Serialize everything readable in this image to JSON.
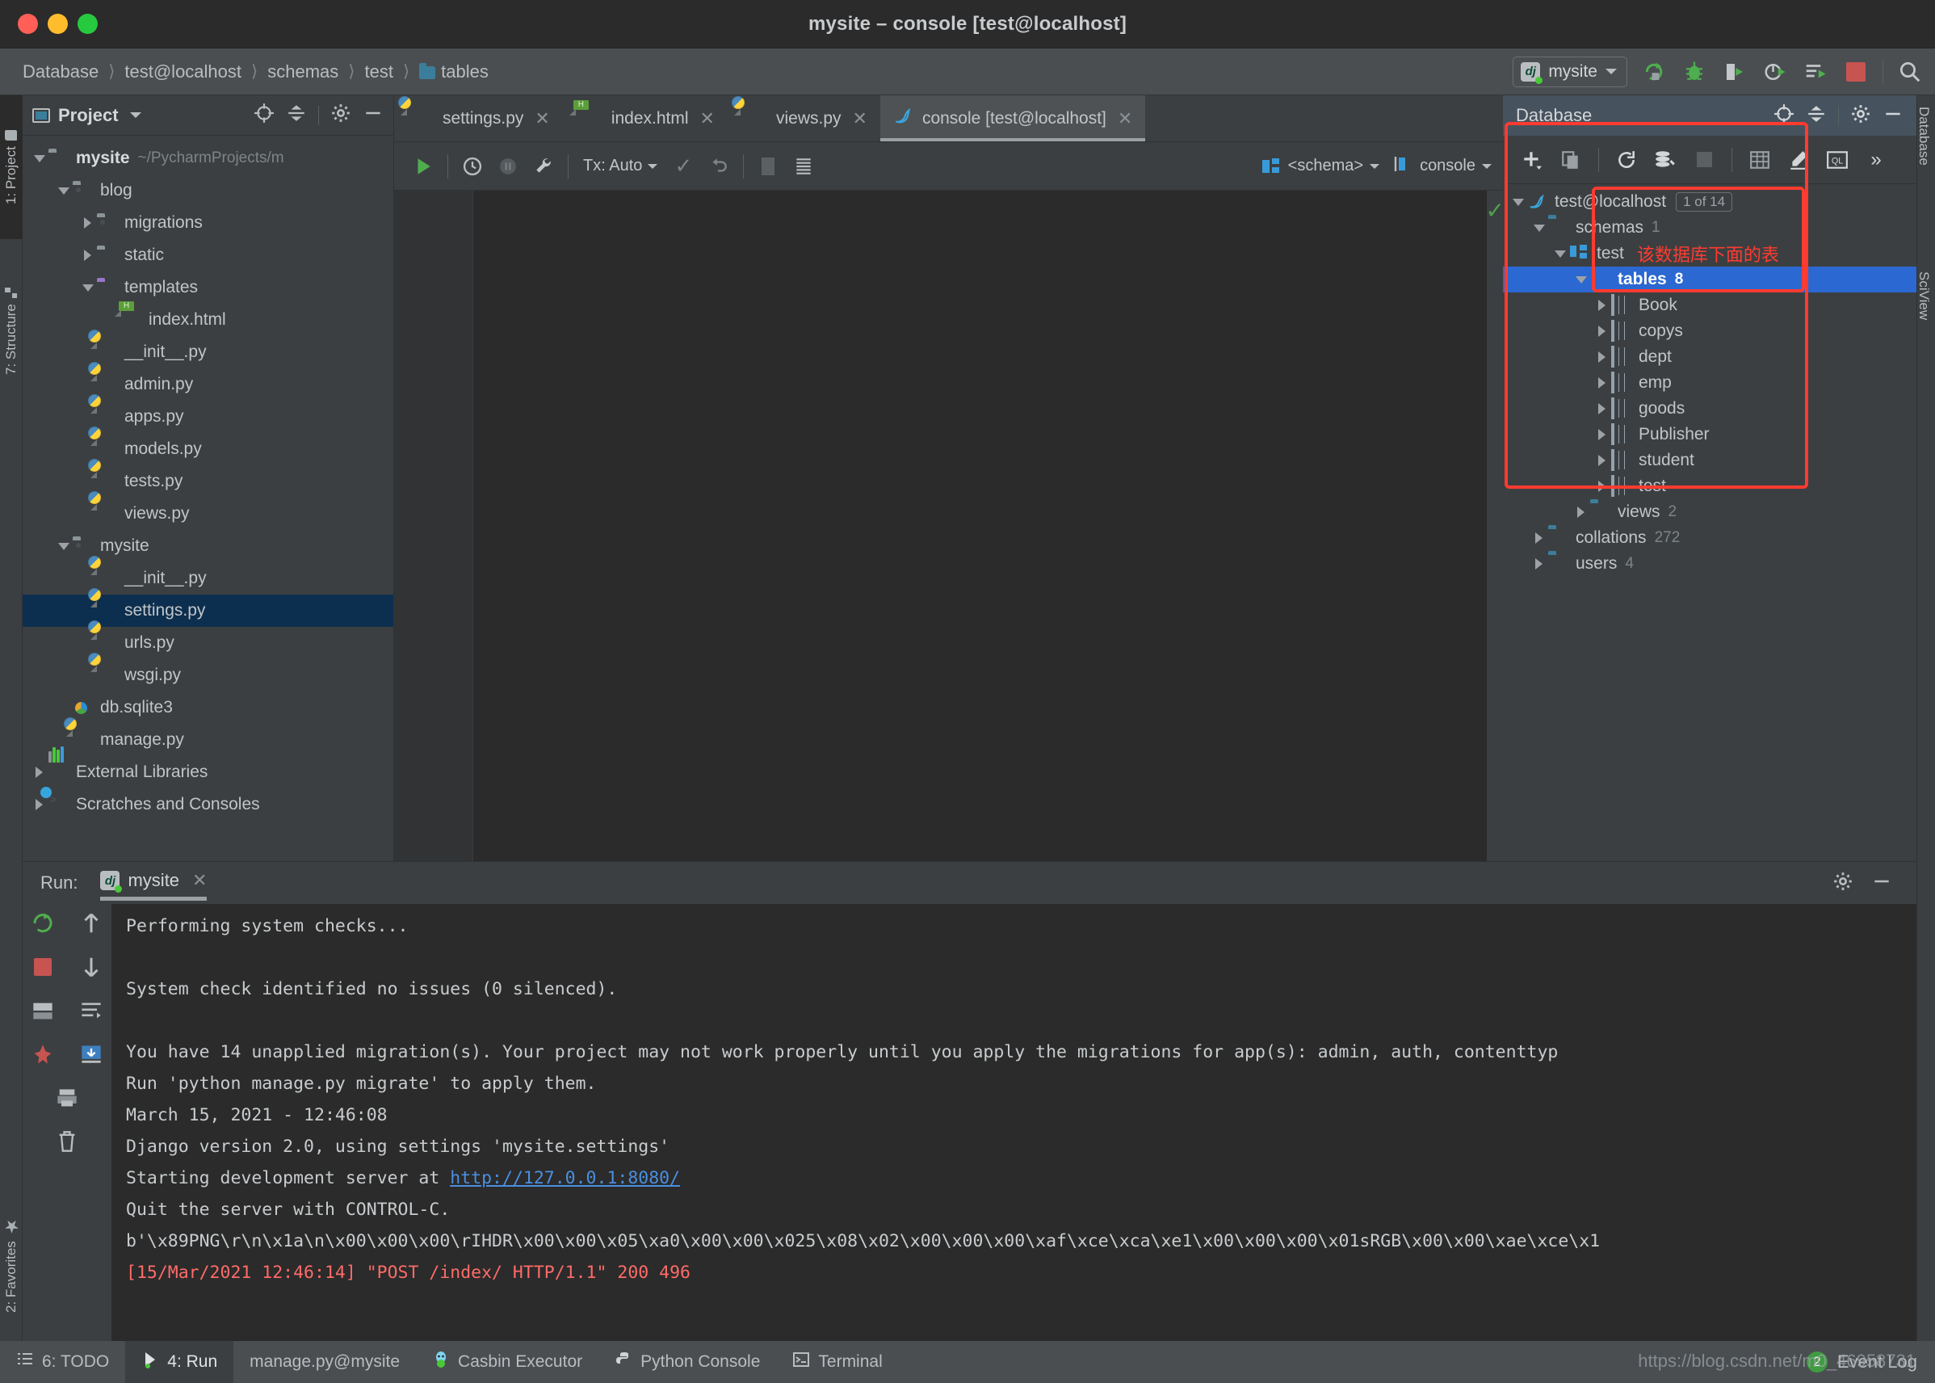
{
  "window": {
    "title": "mysite – console [test@localhost]",
    "traffic_lights": [
      "close",
      "minimize",
      "zoom"
    ]
  },
  "navbar": {
    "breadcrumb": [
      "Database",
      "test@localhost",
      "schemas",
      "test",
      "tables"
    ],
    "run_config": "mysite",
    "icons": [
      "rerun-icon",
      "debug-icon",
      "coverage-icon",
      "profile-icon",
      "run-with-params-icon",
      "stop-icon",
      "search-everywhere-icon"
    ]
  },
  "left_strip": {
    "tabs": [
      {
        "label": "1: Project",
        "icon": "folder-icon",
        "active": true
      },
      {
        "label": "7: Structure",
        "icon": "structure-icon",
        "active": false
      },
      {
        "label": "2: Favorites",
        "icon": "star-icon",
        "active": false
      }
    ]
  },
  "right_strip": {
    "tabs": [
      {
        "label": "Database",
        "active": true
      },
      {
        "label": "SciView",
        "active": false
      }
    ]
  },
  "project": {
    "title": "Project",
    "head_icons": [
      "locate-icon",
      "collapse-all-icon",
      "gear-icon",
      "hide-icon"
    ],
    "tree": [
      {
        "label": "mysite",
        "suffix": "~/PycharmProjects/m",
        "depth": 0,
        "arrow": "down",
        "icon": "folder-icon",
        "bold": true
      },
      {
        "label": "blog",
        "depth": 1,
        "arrow": "down",
        "icon": "source-folder-icon"
      },
      {
        "label": "migrations",
        "depth": 2,
        "arrow": "right",
        "icon": "source-folder-icon"
      },
      {
        "label": "static",
        "depth": 2,
        "arrow": "right",
        "icon": "folder-icon"
      },
      {
        "label": "templates",
        "depth": 2,
        "arrow": "down",
        "icon": "templates-folder-icon"
      },
      {
        "label": "index.html",
        "depth": 3,
        "arrow": "none",
        "icon": "html-file-icon"
      },
      {
        "label": "__init__.py",
        "depth": 2,
        "arrow": "none",
        "icon": "python-file-icon"
      },
      {
        "label": "admin.py",
        "depth": 2,
        "arrow": "none",
        "icon": "python-file-icon"
      },
      {
        "label": "apps.py",
        "depth": 2,
        "arrow": "none",
        "icon": "python-file-icon"
      },
      {
        "label": "models.py",
        "depth": 2,
        "arrow": "none",
        "icon": "python-file-icon"
      },
      {
        "label": "tests.py",
        "depth": 2,
        "arrow": "none",
        "icon": "python-file-icon"
      },
      {
        "label": "views.py",
        "depth": 2,
        "arrow": "none",
        "icon": "python-file-icon"
      },
      {
        "label": "mysite",
        "depth": 1,
        "arrow": "down",
        "icon": "source-folder-icon"
      },
      {
        "label": "__init__.py",
        "depth": 2,
        "arrow": "none",
        "icon": "python-file-icon"
      },
      {
        "label": "settings.py",
        "depth": 2,
        "arrow": "none",
        "icon": "python-file-icon",
        "selected": true
      },
      {
        "label": "urls.py",
        "depth": 2,
        "arrow": "none",
        "icon": "python-file-icon"
      },
      {
        "label": "wsgi.py",
        "depth": 2,
        "arrow": "none",
        "icon": "python-file-icon"
      },
      {
        "label": "db.sqlite3",
        "depth": 1,
        "arrow": "none",
        "icon": "sqlite-file-icon"
      },
      {
        "label": "manage.py",
        "depth": 1,
        "arrow": "none",
        "icon": "python-file-icon"
      },
      {
        "label": "External Libraries",
        "depth": 0,
        "arrow": "right",
        "icon": "libraries-icon"
      },
      {
        "label": "Scratches and Consoles",
        "depth": 0,
        "arrow": "right",
        "icon": "scratches-icon"
      }
    ]
  },
  "editor": {
    "tabs": [
      {
        "label": "settings.py",
        "icon": "python-file-icon",
        "active": false
      },
      {
        "label": "index.html",
        "icon": "html-file-icon",
        "active": false
      },
      {
        "label": "views.py",
        "icon": "python-file-icon",
        "active": false
      },
      {
        "label": "console [test@localhost]",
        "icon": "mysql-dolphin-icon",
        "active": true
      }
    ],
    "toolbar": {
      "tx_label": "Tx: Auto",
      "schema_label": "<schema>",
      "session_label": "console",
      "icons": [
        "execute-icon",
        "history-icon",
        "pause-icon",
        "wrench-icon",
        "commit-icon",
        "rollback-icon",
        "stop-icon",
        "table-icon"
      ]
    },
    "content": ""
  },
  "database": {
    "title": "Database",
    "head_icons": [
      "locate-icon",
      "collapse-all-icon",
      "gear-icon",
      "hide-icon"
    ],
    "toolbar_icons": [
      "add-icon",
      "duplicate-icon",
      "refresh-icon",
      "db-settings-icon",
      "stop-icon",
      "table-editor-icon",
      "modify-icon",
      "query-console-icon",
      "more-icon"
    ],
    "annotation": "该数据库下面的表",
    "tree": [
      {
        "label": "test@localhost",
        "depth": 0,
        "arrow": "down",
        "icon": "mysql-dolphin-icon",
        "badge": "1 of 14"
      },
      {
        "label": "schemas",
        "depth": 1,
        "arrow": "down",
        "icon": "folder-blue-icon",
        "count": "1"
      },
      {
        "label": "test",
        "depth": 2,
        "arrow": "down",
        "icon": "schema-icon",
        "note": "该数据库下面的表"
      },
      {
        "label": "tables",
        "depth": 3,
        "arrow": "down",
        "icon": "tables-folder-icon",
        "count": "8",
        "selected": true
      },
      {
        "label": "Book",
        "depth": 4,
        "arrow": "right",
        "icon": "table-icon"
      },
      {
        "label": "copys",
        "depth": 4,
        "arrow": "right",
        "icon": "table-icon"
      },
      {
        "label": "dept",
        "depth": 4,
        "arrow": "right",
        "icon": "table-icon"
      },
      {
        "label": "emp",
        "depth": 4,
        "arrow": "right",
        "icon": "table-icon"
      },
      {
        "label": "goods",
        "depth": 4,
        "arrow": "right",
        "icon": "table-icon"
      },
      {
        "label": "Publisher",
        "depth": 4,
        "arrow": "right",
        "icon": "table-icon"
      },
      {
        "label": "student",
        "depth": 4,
        "arrow": "right",
        "icon": "table-icon"
      },
      {
        "label": "test",
        "depth": 4,
        "arrow": "right",
        "icon": "table-icon"
      },
      {
        "label": "views",
        "depth": 3,
        "arrow": "right",
        "icon": "folder-blue-icon",
        "count": "2"
      },
      {
        "label": "collations",
        "depth": 1,
        "arrow": "right",
        "icon": "folder-blue-icon",
        "count": "272"
      },
      {
        "label": "users",
        "depth": 1,
        "arrow": "right",
        "icon": "folder-blue-icon",
        "count": "4"
      }
    ]
  },
  "run": {
    "label": "Run:",
    "tab": "mysite",
    "head_icons": [
      "gear-icon",
      "hide-icon"
    ],
    "gutter_icons": [
      "rerun-icon",
      "scroll-up-icon",
      "stop-icon",
      "scroll-down-icon",
      "print-icon",
      "soft-wrap-icon",
      "scroll-to-end-icon",
      "pin-icon",
      "export-icon",
      "clear-all-icon"
    ],
    "console_lines": [
      {
        "text": "Performing system checks...",
        "type": "normal"
      },
      {
        "text": "",
        "type": "normal"
      },
      {
        "text": "System check identified no issues (0 silenced).",
        "type": "normal"
      },
      {
        "text": "",
        "type": "normal"
      },
      {
        "text": "You have 14 unapplied migration(s). Your project may not work properly until you apply the migrations for app(s): admin, auth, contenttyp",
        "type": "normal"
      },
      {
        "text": "Run 'python manage.py migrate' to apply them.",
        "type": "normal"
      },
      {
        "text": "March 15, 2021 - 12:46:08",
        "type": "normal"
      },
      {
        "text": "Django version 2.0, using settings 'mysite.settings'",
        "type": "normal"
      },
      {
        "text": "Starting development server at ",
        "type": "link",
        "link": "http://127.0.0.1:8080/"
      },
      {
        "text": "Quit the server with CONTROL-C.",
        "type": "normal"
      },
      {
        "text": "b'\\x89PNG\\r\\n\\x1a\\n\\x00\\x00\\x00\\rIHDR\\x00\\x00\\x05\\xa0\\x00\\x00\\x025\\x08\\x02\\x00\\x00\\x00\\xaf\\xce\\xca\\xe1\\x00\\x00\\x00\\x01sRGB\\x00\\x00\\xae\\xce\\x1",
        "type": "normal"
      },
      {
        "text": "[15/Mar/2021 12:46:14] \"POST /index/ HTTP/1.1\" 200 496",
        "type": "error"
      }
    ]
  },
  "statusbar": {
    "items": [
      {
        "label": "6: TODO",
        "icon": "todo-icon",
        "active": false
      },
      {
        "label": "4: Run",
        "icon": "run-icon",
        "active": true
      },
      {
        "label": "manage.py@mysite",
        "icon": "none",
        "active": false
      },
      {
        "label": "Casbin Executor",
        "icon": "casbin-icon",
        "active": false
      },
      {
        "label": "Python Console",
        "icon": "python-icon",
        "active": false
      },
      {
        "label": "Terminal",
        "icon": "terminal-icon",
        "active": false
      }
    ],
    "event_log": "Event Log",
    "event_count": "2",
    "watermark": "https://blog.csdn.net/m0_46958731"
  },
  "colors": {
    "accent_blue": "#2b68d1",
    "annotation_red": "#ff3b30",
    "selection_navy": "#0d2f4f",
    "panel_bg": "#3c3f41",
    "console_bg": "#2b2b2b",
    "link_blue": "#4a8fe0",
    "error_red": "#ff6b68"
  }
}
